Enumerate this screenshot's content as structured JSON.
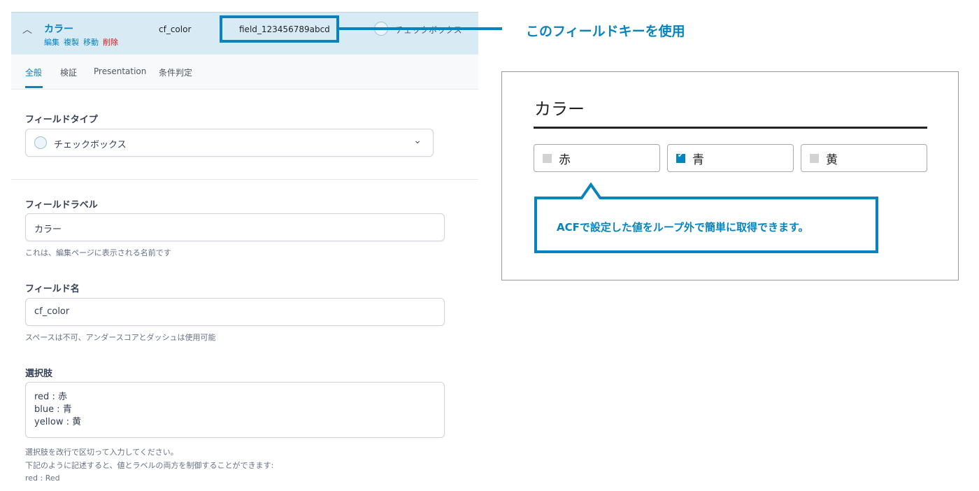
{
  "header": {
    "field_label": "カラー",
    "actions": {
      "edit": "編集",
      "duplicate": "複製",
      "move": "移動",
      "delete": "削除"
    },
    "field_name": "cf_color",
    "field_key": "field_123456789abcd",
    "field_type": "チェックボックス"
  },
  "tabs": [
    {
      "label": "全般",
      "active": true
    },
    {
      "label": "検証"
    },
    {
      "label": "Presentation"
    },
    {
      "label": "条件判定"
    }
  ],
  "form": {
    "field_type": {
      "label": "フィールドタイプ",
      "value": "チェックボックス"
    },
    "field_label": {
      "label": "フィールドラベル",
      "value": "カラー",
      "hint": "これは、編集ページに表示される名前です"
    },
    "field_name": {
      "label": "フィールド名",
      "value": "cf_color",
      "hint": "スペースは不可、アンダースコアとダッシュは使用可能"
    },
    "choices": {
      "label": "選択肢",
      "lines": [
        "red : 赤",
        "blue : 青",
        "yellow : 黄"
      ],
      "hints": [
        "選択肢を改行で区切って入力してください。",
        "下記のように記述すると、値とラベルの両方を制御することができます:",
        "red : Red"
      ]
    }
  },
  "annotation": {
    "key_callout": "このフィールドキーを使用",
    "tooltip": "ACFで設定した値をループ外で簡単に取得できます。"
  },
  "preview": {
    "title": "カラー",
    "options": [
      {
        "label": "赤",
        "checked": false
      },
      {
        "label": "青",
        "checked": true
      },
      {
        "label": "黄",
        "checked": false
      }
    ]
  },
  "colors": {
    "accent": "#0783be",
    "header_bg": "#d8eaf4",
    "delete": "#cc1818"
  }
}
